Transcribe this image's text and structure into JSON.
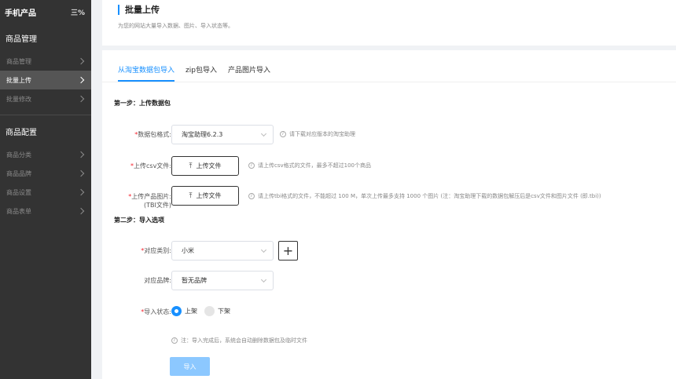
{
  "sidebar": {
    "title": "手机产品",
    "toggle_icon": "三%",
    "groups": [
      {
        "title": "商品管理",
        "items": [
          "商品管理",
          "批量上传",
          "批量修改"
        ]
      },
      {
        "title": "商品配置",
        "items": [
          "商品分类",
          "商品品牌",
          "商品设置",
          "商品表单"
        ]
      }
    ],
    "active_item": "批量上传"
  },
  "header": {
    "title": "批量上传",
    "subtitle": "为您的网站大量导入数据、图片、导入状态等。"
  },
  "tabs": [
    "从淘宝数据包导入",
    "zip包导入",
    "产品图片导入"
  ],
  "step1": {
    "title": "第一步：上传数据包",
    "format": {
      "label": "数据包格式:",
      "value": "淘宝助理6.2.3",
      "hint": "请下载对应版本的淘宝助理"
    },
    "csv": {
      "label": "上传csv文件:",
      "button": "上传文件",
      "hint": "请上传csv格式的文件，最多不超过100个商品"
    },
    "tbi": {
      "label": "上传产品图片:",
      "label2": "(TBI文件)",
      "button": "上传文件",
      "hint": "请上传tbi格式的文件，不能超过 100 M，单次上传最多支持 1000 个图片 (注：淘宝助理下载的数据包解压后是csv文件和图片文件 (即.tbi))"
    }
  },
  "step2": {
    "title": "第二步：导入选项",
    "category": {
      "label": "对应类别:",
      "value": "小米"
    },
    "brand": {
      "label": "对应品牌:",
      "value": "暂无品牌"
    },
    "status": {
      "label": "导入状态:",
      "on": "上架",
      "off": "下架"
    },
    "note": "注：导入完成后，系统会自动删除数据包及临时文件",
    "submit": "导入"
  },
  "colors": {
    "accent": "#1890ff",
    "sidebar_bg": "#333333",
    "required": "#f5222d"
  }
}
